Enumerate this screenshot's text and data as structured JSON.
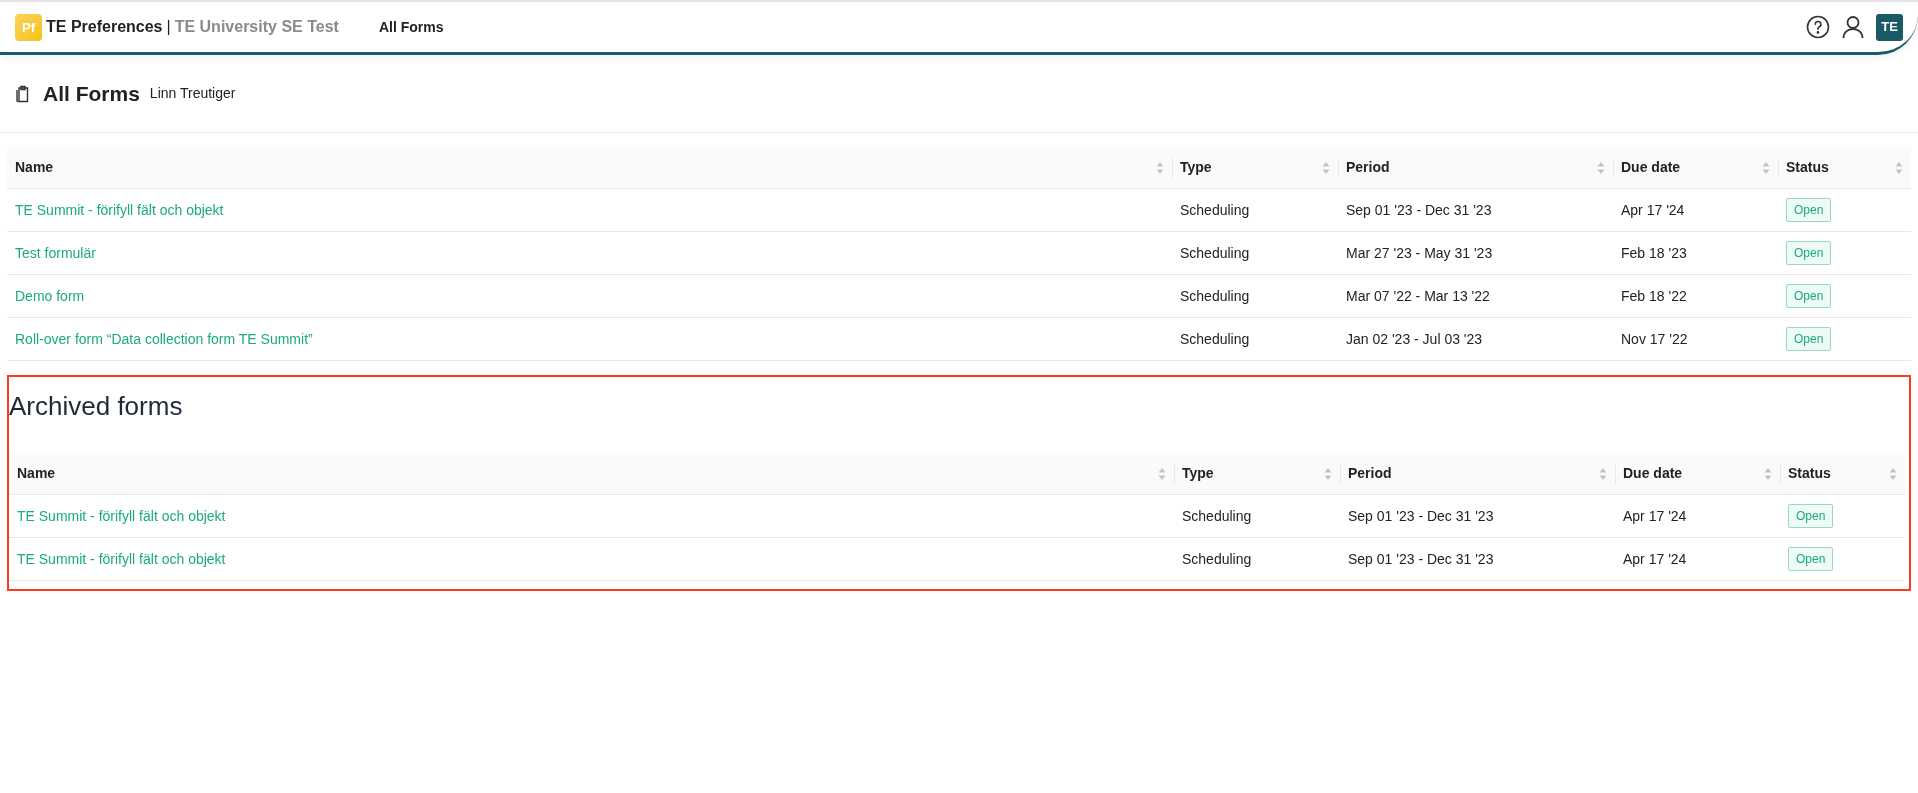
{
  "header": {
    "logo": {
      "letters": "Pf"
    },
    "app_name": "TE Preferences",
    "separator": "|",
    "org_name": "TE University SE Test",
    "nav": [
      {
        "label": "All Forms",
        "selected": true
      }
    ],
    "avatar": "TE"
  },
  "page": {
    "title": "All Forms",
    "user": "Linn Treutiger"
  },
  "tables": [
    {
      "columns": [
        "Name",
        "Type",
        "Period",
        "Due date",
        "Status"
      ],
      "rows": [
        {
          "name": "TE Summit - förifyll fält och objekt",
          "type": "Scheduling",
          "period": "Sep 01 '23 - Dec 31 '23",
          "due": "Apr 17 '24",
          "status": "Open"
        },
        {
          "name": "Test formulär",
          "type": "Scheduling",
          "period": "Mar 27 '23 - May 31 '23",
          "due": "Feb 18 '23",
          "status": "Open"
        },
        {
          "name": "Demo form",
          "type": "Scheduling",
          "period": "Mar 07 '22 - Mar 13 '22",
          "due": "Feb 18 '22",
          "status": "Open"
        },
        {
          "name": "Roll-over form “Data collection form TE Summit”",
          "type": "Scheduling",
          "period": "Jan 02 '23 - Jul 03 '23",
          "due": "Nov 17 '22",
          "status": "Open"
        }
      ]
    },
    {
      "title": "Archived forms",
      "highlighted": true,
      "columns": [
        "Name",
        "Type",
        "Period",
        "Due date",
        "Status"
      ],
      "rows": [
        {
          "name": "TE Summit - förifyll fält och objekt",
          "type": "Scheduling",
          "period": "Sep 01 '23 - Dec 31 '23",
          "due": "Apr 17 '24",
          "status": "Open"
        },
        {
          "name": "TE Summit - förifyll fält och objekt",
          "type": "Scheduling",
          "period": "Sep 01 '23 - Dec 31 '23",
          "due": "Apr 17 '24",
          "status": "Open"
        }
      ]
    }
  ]
}
